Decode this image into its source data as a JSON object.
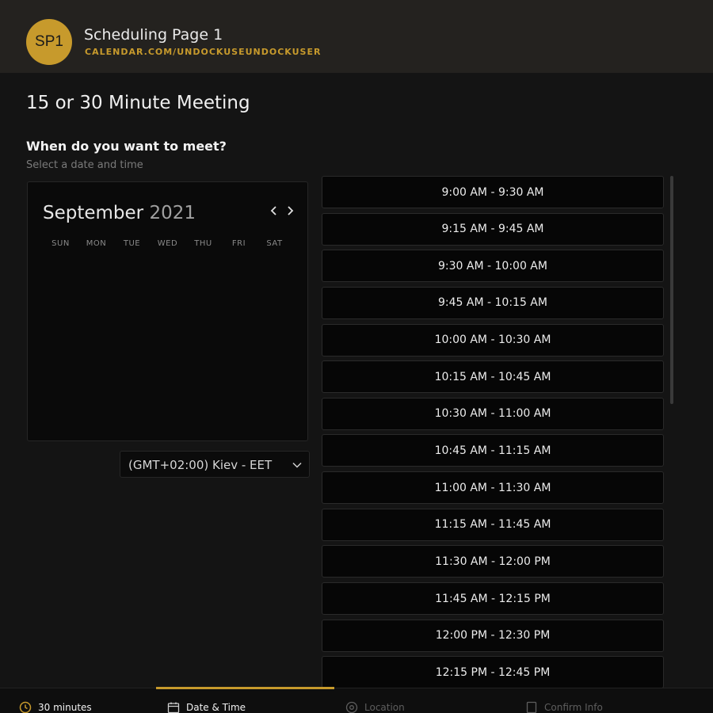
{
  "header": {
    "avatar_initials": "SP1",
    "title": "Scheduling Page 1",
    "url": "CALENDAR.COM/UNDOCKUSEUNDOCKUSER"
  },
  "meeting": {
    "title": "15 or 30 Minute Meeting",
    "question": "When do you want to meet?",
    "subtitle": "Select a date and time"
  },
  "calendar": {
    "month": "September",
    "year": "2021",
    "prev_icon": "chevron-left-icon",
    "next_icon": "chevron-right-icon",
    "weekdays": [
      "SUN",
      "MON",
      "TUE",
      "WED",
      "THU",
      "FRI",
      "SAT"
    ]
  },
  "timezone": {
    "value": "(GMT+02:00) Kiev - EET"
  },
  "slots": [
    "9:00 AM - 9:30 AM",
    "9:15 AM - 9:45 AM",
    "9:30 AM - 10:00 AM",
    "9:45 AM - 10:15 AM",
    "10:00 AM - 10:30 AM",
    "10:15 AM - 10:45 AM",
    "10:30 AM - 11:00 AM",
    "10:45 AM - 11:15 AM",
    "11:00 AM - 11:30 AM",
    "11:15 AM - 11:45 AM",
    "11:30 AM - 12:00 PM",
    "11:45 AM - 12:15 PM",
    "12:00 PM - 12:30 PM",
    "12:15 PM - 12:45 PM"
  ],
  "footer": {
    "steps": [
      {
        "label": "30 minutes",
        "icon": "clock-icon"
      },
      {
        "label": "Date & Time",
        "icon": "calendar-icon"
      },
      {
        "label": "Location",
        "icon": "location-icon"
      },
      {
        "label": "Confirm Info",
        "icon": "document-icon"
      }
    ]
  },
  "colors": {
    "accent": "#c79a2c",
    "background": "#141414",
    "header": "#24221f"
  }
}
